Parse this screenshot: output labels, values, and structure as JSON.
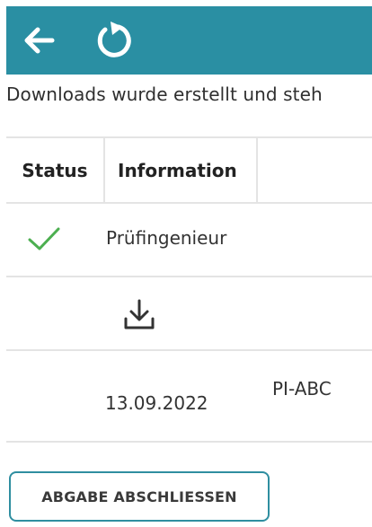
{
  "toolbar": {
    "back_icon": "arrow-left-icon",
    "refresh_icon": "refresh-icon",
    "background_color": "#2a8fa3"
  },
  "message": "Downloads wurde erstellt und steh",
  "table": {
    "columns": [
      "Status",
      "Information"
    ],
    "rows": [
      {
        "status_icon": "checkmark-icon",
        "information": "Prüfingenieur"
      },
      {
        "action_icon": "download-icon"
      },
      {
        "date": "13.09.2022",
        "code": "PI-ABC"
      }
    ]
  },
  "submit_button": {
    "label": "ABGABE ABSCHLIESSEN",
    "border_color": "#2f8ea0"
  },
  "colors": {
    "success": "#4caf50",
    "divider": "#e4e4e4"
  }
}
